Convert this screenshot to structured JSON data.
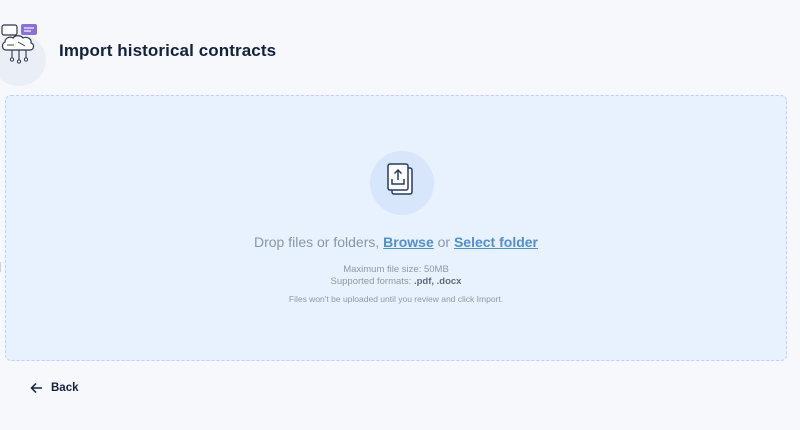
{
  "header": {
    "title": "Import historical contracts",
    "icon": "brain-network-chat-icon"
  },
  "dropzone": {
    "icon": "upload-file-icon",
    "prompt_text": "Drop files or folders, ",
    "browse_label": "Browse",
    "or_text": " or ",
    "select_folder_label": "Select folder",
    "max_size_text": "Maximum file size: 50MB",
    "formats_prefix": "Supported formats: ",
    "formats_value": ".pdf, .docx",
    "note": "Files won't be uploaded until you review and click Import."
  },
  "footer": {
    "back_label": "Back",
    "back_icon": "arrow-left-icon"
  },
  "colors": {
    "title": "#14213d",
    "link": "#4e8fd6",
    "dropzone_bg": "#e8f1fe",
    "dropzone_border": "#bcd3f2"
  }
}
